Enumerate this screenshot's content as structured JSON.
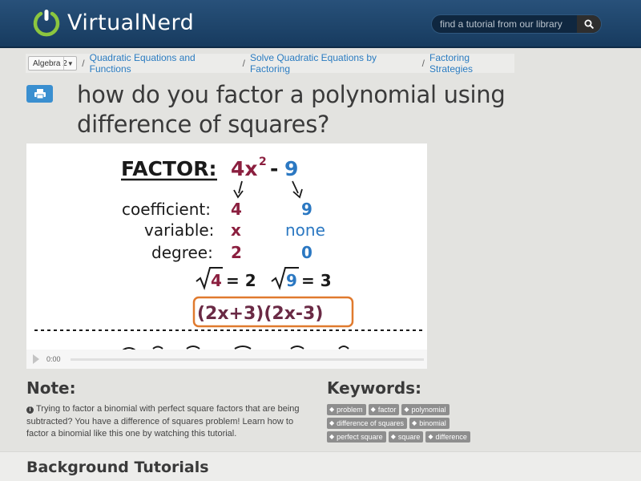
{
  "header": {
    "logo_word_1": "Virtual",
    "logo_word_2": "Nerd",
    "search_placeholder": "find a tutorial from our library",
    "search_icon": "search-icon"
  },
  "breadcrumb": {
    "course_select": "Algebra 2",
    "items": [
      "Quadratic Equations and Functions",
      "Solve Quadratic Equations by Factoring",
      "Factoring Strategies"
    ]
  },
  "page": {
    "title": "how do you factor a polynomial using difference of squares?"
  },
  "video": {
    "heading": "FACTOR:",
    "expr_term1": "4x",
    "expr_exp": "2",
    "expr_minus": "-",
    "expr_term2": "9",
    "label_coefficient": "coefficient:",
    "label_variable": "variable:",
    "label_degree": "degree:",
    "coef_1": "4",
    "coef_2": "9",
    "var_1": "x",
    "var_2": "none",
    "deg_1": "2",
    "deg_2": "0",
    "root_1": "4",
    "root_1_result": "= 2",
    "root_2": "9",
    "root_2_result": "= 3",
    "answer": "(2x+3)(2x-3)",
    "time": "0:00"
  },
  "note": {
    "heading": "Note:",
    "text": "Trying to factor a binomial with perfect square factors that are being subtracted? You have a difference of squares problem! Learn how to factor a binomial like this one by watching this tutorial."
  },
  "keywords": {
    "heading": "Keywords:",
    "tags": [
      "problem",
      "factor",
      "polynomial",
      "difference of squares",
      "binomial",
      "perfect square",
      "square",
      "difference"
    ]
  },
  "background": {
    "heading": "Background Tutorials"
  },
  "colors": {
    "header_blue": "#1e4670",
    "accent_green": "#8cc63f",
    "link_blue": "#2a7bc0",
    "maroon": "#8b1f3f",
    "blue_math": "#2b78c2",
    "answer_box": "#e07a2e"
  }
}
